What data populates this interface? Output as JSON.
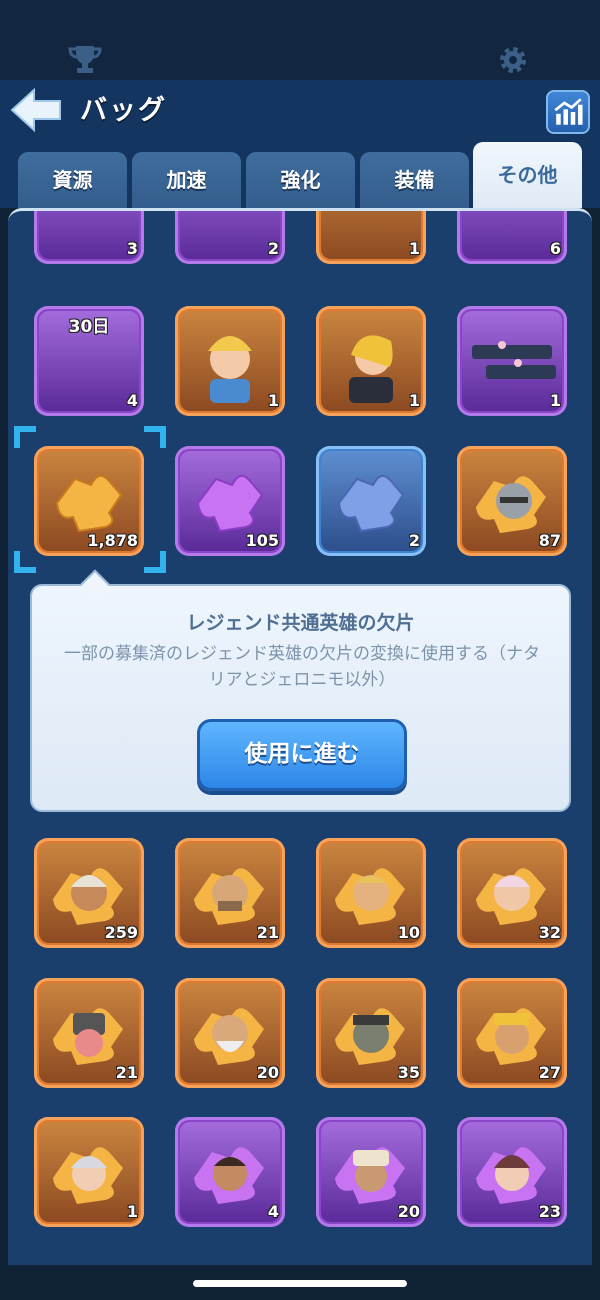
{
  "header": {
    "title": "バッグ",
    "back_icon": "back-arrow-icon",
    "stats_icon": "stats-chart-icon"
  },
  "topbar": {
    "left_icon": "trophy-icon",
    "right_icon": "gear-icon"
  },
  "tabs": [
    {
      "label": "資源",
      "active": false
    },
    {
      "label": "加速",
      "active": false
    },
    {
      "label": "強化",
      "active": false
    },
    {
      "label": "装備",
      "active": false
    },
    {
      "label": "その他",
      "active": true
    }
  ],
  "items_row0": [
    {
      "name": "frame-item-1",
      "count": "3",
      "rarity": "epic"
    },
    {
      "name": "frame-item-2",
      "count": "2",
      "rarity": "epic"
    },
    {
      "name": "frame-item-3",
      "count": "1",
      "rarity": "legend"
    },
    {
      "name": "frame-item-4",
      "count": "6",
      "rarity": "epic"
    }
  ],
  "items_row1": [
    {
      "name": "frame-30day",
      "count": "4",
      "badge": "30日",
      "rarity": "epic"
    },
    {
      "name": "avatar-item-1",
      "count": "1",
      "rarity": "legend"
    },
    {
      "name": "avatar-item-2",
      "count": "1",
      "rarity": "legend"
    },
    {
      "name": "nameplate-item",
      "count": "1",
      "rarity": "epic"
    }
  ],
  "items_row2": [
    {
      "name": "legend-universal-shard",
      "count": "1,878",
      "rarity": "legend",
      "selected": true
    },
    {
      "name": "epic-universal-shard",
      "count": "105",
      "rarity": "epic"
    },
    {
      "name": "rare-universal-shard",
      "count": "2",
      "rarity": "rare"
    },
    {
      "name": "hero-shard-1",
      "count": "87",
      "rarity": "legend"
    }
  ],
  "tooltip": {
    "title": "レジェンド共通英雄の欠片",
    "description": "一部の募集済のレジェンド英雄の欠片の変換に使用する（ナタリアとジェロニモ以外）",
    "button_label": "使用に進む"
  },
  "items_row3": [
    {
      "count": "259",
      "rarity": "legend"
    },
    {
      "count": "21",
      "rarity": "legend"
    },
    {
      "count": "10",
      "rarity": "legend"
    },
    {
      "count": "32",
      "rarity": "legend"
    }
  ],
  "items_row4": [
    {
      "count": "21",
      "rarity": "legend"
    },
    {
      "count": "20",
      "rarity": "legend"
    },
    {
      "count": "35",
      "rarity": "legend"
    },
    {
      "count": "27",
      "rarity": "legend"
    }
  ],
  "items_row5": [
    {
      "count": "1",
      "rarity": "legend"
    },
    {
      "count": "4",
      "rarity": "epic"
    },
    {
      "count": "20",
      "rarity": "epic"
    },
    {
      "count": "23",
      "rarity": "epic"
    }
  ],
  "colors": {
    "legend": "#e07a2e",
    "epic": "#8a45c9",
    "rare": "#3f82d0",
    "selection": "#33b3ee"
  }
}
